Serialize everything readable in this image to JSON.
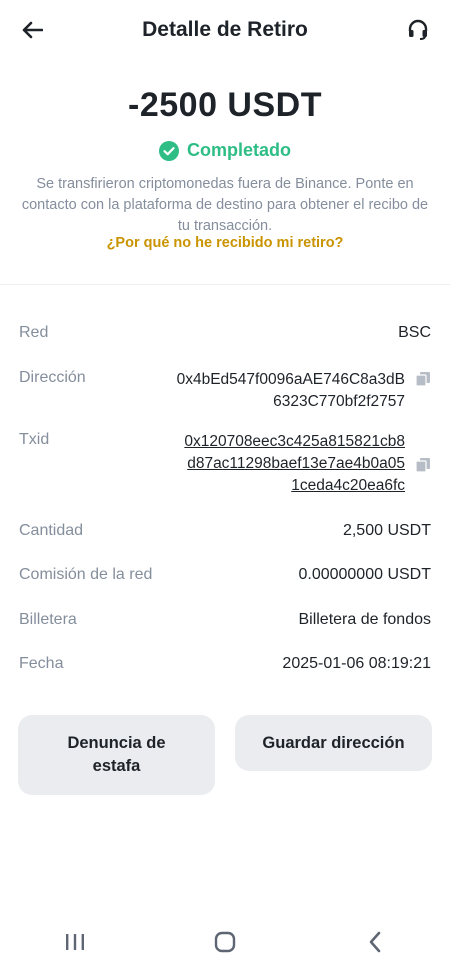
{
  "header": {
    "title": "Detalle de Retiro"
  },
  "summary": {
    "amount": "-2500 USDT",
    "status": "Completado",
    "info": "Se transfirieron criptomonedas fuera de Binance. Ponte en contacto con la plataforma de destino para obtener el recibo de tu transacción.",
    "why_link": "¿Por qué no he recibido mi retiro?"
  },
  "details": {
    "red": {
      "label": "Red",
      "value": "BSC"
    },
    "direccion": {
      "label": "Dirección",
      "line1": "0x4bEd547f0096aAE746C8a3dB",
      "line2": "6323C770bf2f2757"
    },
    "txid": {
      "label": "Txid",
      "line1": "0x120708eec3c425a815821cb8",
      "line2": "d87ac11298baef13e7ae4b0a05",
      "line3": "1ceda4c20ea6fc"
    },
    "cantidad": {
      "label": "Cantidad",
      "value": "2,500 USDT"
    },
    "comision": {
      "label": "Comisión de la red",
      "value": "0.00000000 USDT"
    },
    "billetera": {
      "label": "Billetera",
      "value": "Billetera de fondos"
    },
    "fecha": {
      "label": "Fecha",
      "value": "2025-01-06 08:19:21"
    }
  },
  "actions": {
    "report_line1": "Denuncia de",
    "report_line2": "estafa",
    "save_address": "Guardar dirección"
  },
  "colors": {
    "success": "#2ebd85",
    "link": "#c99400",
    "muted": "#848e9c"
  }
}
